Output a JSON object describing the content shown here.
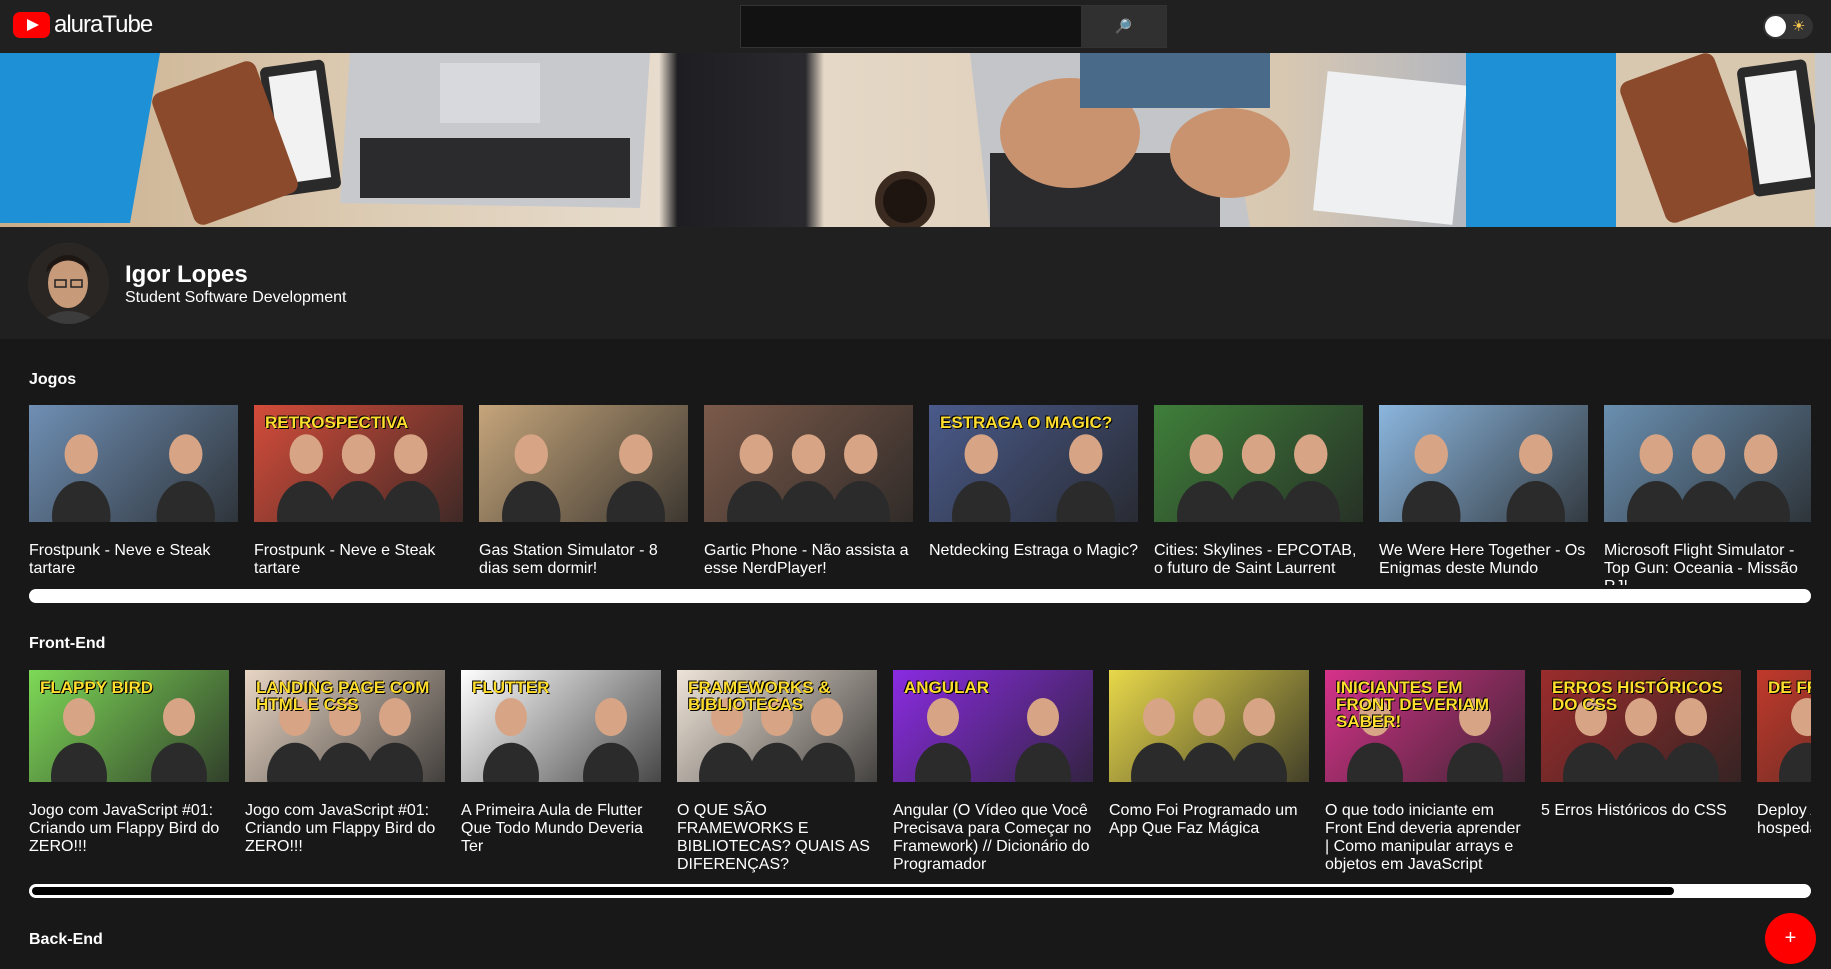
{
  "header": {
    "logo_text": "aluraTube",
    "search_placeholder": "",
    "search_icon": "🔎",
    "theme_icon": "☀"
  },
  "profile": {
    "name": "Igor Lopes",
    "job": "Student Software Development"
  },
  "sections": [
    {
      "title": "Jogos",
      "videos": [
        {
          "title": "Frostpunk - Neve e Steak tartare",
          "color": "#6f8fb4"
        },
        {
          "title": "Frostpunk - Neve e Steak tartare",
          "color": "#d44c3a",
          "thumb_text": "RETROSPECTIVA"
        },
        {
          "title": "Gas Station Simulator - 8 dias sem dormir!",
          "color": "#c5a57b"
        },
        {
          "title": "Gartic Phone - Não assista a esse NerdPlayer!",
          "color": "#7b5a4a"
        },
        {
          "title": "Netdecking Estraga o Magic?",
          "color": "#4a5a8a",
          "thumb_text": "ESTRAGA O MAGIC?"
        },
        {
          "title": "Cities: Skylines - EPCOTAB, o futuro de Saint Laurrent",
          "color": "#3f7f3a"
        },
        {
          "title": "We Were Here Together - Os Enigmas deste Mundo",
          "color": "#8bb6de"
        },
        {
          "title": "Microsoft Flight Simulator - Top Gun: Oceania - Missão RJ!",
          "color": "#6a8fb0"
        }
      ]
    },
    {
      "title": "Front-End",
      "videos": [
        {
          "title": "Jogo com JavaScript #01: Criando um Flappy Bird do ZERO!!!",
          "color": "#7ed957",
          "thumb_text": "Flappy Bird"
        },
        {
          "title": "Jogo com JavaScript #01: Criando um Flappy Bird do ZERO!!!",
          "color": "#e8d5c4",
          "thumb_text": "LANDING PAGE COM HTML E CSS"
        },
        {
          "title": "A Primeira Aula de Flutter Que Todo Mundo Deveria Ter",
          "color": "#ffffff",
          "thumb_text": "Flutter"
        },
        {
          "title": "O QUE SÃO FRAMEWORKS E BIBLIOTECAS? QUAIS AS DIFERENÇAS?",
          "color": "#efe4d8",
          "thumb_text": "FRAMEWORKS & BIBLIOTECAS"
        },
        {
          "title": "Angular (O Vídeo que Você Precisava para Começar no Framework) // Dicionário do Programador",
          "color": "#8a2be2",
          "thumb_text": "ANGULAR"
        },
        {
          "title": "Como Foi Programado um App Que Faz Mágica",
          "color": "#e8d84a"
        },
        {
          "title": "O que todo iniciante em Front End deveria aprender | Como manipular arrays e objetos em JavaScript",
          "color": "#d6328a",
          "thumb_text": "INICIANTES EM FRONT DEVERIAM SABER!"
        },
        {
          "title": "5 Erros Históricos do CSS",
          "color": "#9b2c2c",
          "thumb_text": "ERROS HISTÓRICOS DO CSS"
        },
        {
          "title": "Deploy ATUALI eu uso p hospeda End",
          "color": "#c0392b",
          "thumb_text": "DE FRON VE"
        }
      ]
    },
    {
      "title": "Back-End",
      "videos": []
    }
  ],
  "fab": {
    "label": "+"
  }
}
